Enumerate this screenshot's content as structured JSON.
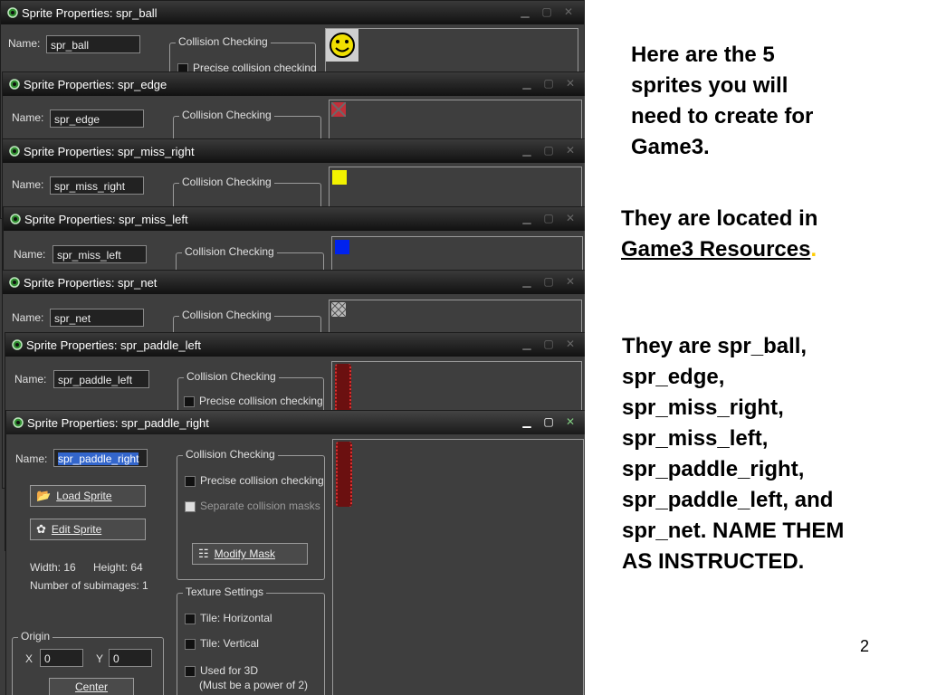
{
  "windows": [
    {
      "title": "Sprite Properties: spr_ball",
      "name": "spr_ball",
      "collision_label": "Collision Checking",
      "precise_label": "Precise collision checking",
      "sprite": "smiley"
    },
    {
      "title": "Sprite Properties: spr_edge",
      "name": "spr_edge",
      "collision_label": "Collision Checking",
      "sprite": "edge"
    },
    {
      "title": "Sprite Properties: spr_miss_right",
      "name": "spr_miss_right",
      "collision_label": "Collision Checking",
      "sprite": "yellow-square"
    },
    {
      "title": "Sprite Properties: spr_miss_left",
      "name": "spr_miss_left",
      "collision_label": "Collision Checking",
      "sprite": "blue-square"
    },
    {
      "title": "Sprite Properties: spr_net",
      "name": "spr_net",
      "collision_label": "Collision Checking",
      "sprite": "net"
    },
    {
      "title": "Sprite Properties: spr_paddle_left",
      "name": "spr_paddle_left",
      "collision_label": "Collision Checking",
      "precise_label": "Precise collision checking",
      "sprite": "paddle"
    }
  ],
  "active_window": {
    "title": "Sprite Properties: spr_paddle_right",
    "name_label": "Name:",
    "name_value": "spr_paddle_right",
    "load_sprite": "Load Sprite",
    "edit_sprite": "Edit Sprite",
    "width_text": "Width: 16",
    "height_text": "Height: 64",
    "subimages_text": "Number of subimages: 1",
    "collision_label": "Collision Checking",
    "precise_label": "Precise collision checking",
    "separate_label": "Separate collision masks",
    "modify_mask": "Modify Mask",
    "texture_label": "Texture Settings",
    "tile_h": "Tile: Horizontal",
    "tile_v": "Tile: Vertical",
    "used_3d": "Used for 3D",
    "power2": "(Must be a power of 2)",
    "origin_label": "Origin",
    "x_label": "X",
    "x_value": "0",
    "y_label": "Y",
    "y_value": "0",
    "center": "Center"
  },
  "name_label": "Name:",
  "text": {
    "para1": [
      "Here are the 5",
      "sprites you will",
      "need to create for",
      "Game3."
    ],
    "para2_line1": "They are located in",
    "para2_link": "Game3 Resources",
    "para2_end": ".",
    "para3": [
      "They are spr_ball,",
      "spr_edge,",
      "spr_miss_right,",
      "spr_miss_left,",
      "spr_paddle_right,",
      "spr_paddle_left, and",
      "spr_net.  NAME THEM",
      "AS INSTRUCTED."
    ],
    "page_number": "2"
  },
  "colors": {
    "accent_yellow": "#ffcc00",
    "selection": "#3366cc"
  }
}
